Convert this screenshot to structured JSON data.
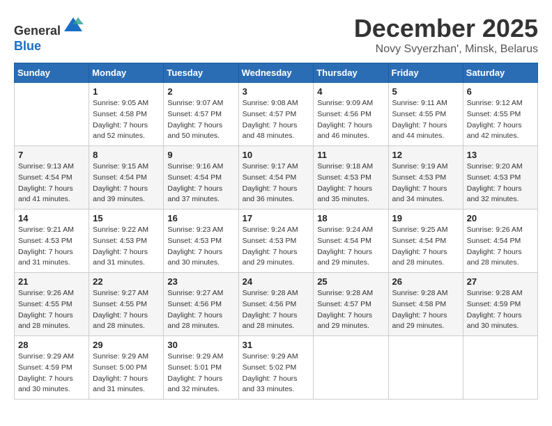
{
  "header": {
    "logo_line1": "General",
    "logo_line2": "Blue",
    "month_title": "December 2025",
    "subtitle": "Novy Svyerzhan', Minsk, Belarus"
  },
  "weekdays": [
    "Sunday",
    "Monday",
    "Tuesday",
    "Wednesday",
    "Thursday",
    "Friday",
    "Saturday"
  ],
  "weeks": [
    [
      {
        "day": "",
        "info": ""
      },
      {
        "day": "1",
        "info": "Sunrise: 9:05 AM\nSunset: 4:58 PM\nDaylight: 7 hours\nand 52 minutes."
      },
      {
        "day": "2",
        "info": "Sunrise: 9:07 AM\nSunset: 4:57 PM\nDaylight: 7 hours\nand 50 minutes."
      },
      {
        "day": "3",
        "info": "Sunrise: 9:08 AM\nSunset: 4:57 PM\nDaylight: 7 hours\nand 48 minutes."
      },
      {
        "day": "4",
        "info": "Sunrise: 9:09 AM\nSunset: 4:56 PM\nDaylight: 7 hours\nand 46 minutes."
      },
      {
        "day": "5",
        "info": "Sunrise: 9:11 AM\nSunset: 4:55 PM\nDaylight: 7 hours\nand 44 minutes."
      },
      {
        "day": "6",
        "info": "Sunrise: 9:12 AM\nSunset: 4:55 PM\nDaylight: 7 hours\nand 42 minutes."
      }
    ],
    [
      {
        "day": "7",
        "info": "Sunrise: 9:13 AM\nSunset: 4:54 PM\nDaylight: 7 hours\nand 41 minutes."
      },
      {
        "day": "8",
        "info": "Sunrise: 9:15 AM\nSunset: 4:54 PM\nDaylight: 7 hours\nand 39 minutes."
      },
      {
        "day": "9",
        "info": "Sunrise: 9:16 AM\nSunset: 4:54 PM\nDaylight: 7 hours\nand 37 minutes."
      },
      {
        "day": "10",
        "info": "Sunrise: 9:17 AM\nSunset: 4:54 PM\nDaylight: 7 hours\nand 36 minutes."
      },
      {
        "day": "11",
        "info": "Sunrise: 9:18 AM\nSunset: 4:53 PM\nDaylight: 7 hours\nand 35 minutes."
      },
      {
        "day": "12",
        "info": "Sunrise: 9:19 AM\nSunset: 4:53 PM\nDaylight: 7 hours\nand 34 minutes."
      },
      {
        "day": "13",
        "info": "Sunrise: 9:20 AM\nSunset: 4:53 PM\nDaylight: 7 hours\nand 32 minutes."
      }
    ],
    [
      {
        "day": "14",
        "info": "Sunrise: 9:21 AM\nSunset: 4:53 PM\nDaylight: 7 hours\nand 31 minutes."
      },
      {
        "day": "15",
        "info": "Sunrise: 9:22 AM\nSunset: 4:53 PM\nDaylight: 7 hours\nand 31 minutes."
      },
      {
        "day": "16",
        "info": "Sunrise: 9:23 AM\nSunset: 4:53 PM\nDaylight: 7 hours\nand 30 minutes."
      },
      {
        "day": "17",
        "info": "Sunrise: 9:24 AM\nSunset: 4:53 PM\nDaylight: 7 hours\nand 29 minutes."
      },
      {
        "day": "18",
        "info": "Sunrise: 9:24 AM\nSunset: 4:54 PM\nDaylight: 7 hours\nand 29 minutes."
      },
      {
        "day": "19",
        "info": "Sunrise: 9:25 AM\nSunset: 4:54 PM\nDaylight: 7 hours\nand 28 minutes."
      },
      {
        "day": "20",
        "info": "Sunrise: 9:26 AM\nSunset: 4:54 PM\nDaylight: 7 hours\nand 28 minutes."
      }
    ],
    [
      {
        "day": "21",
        "info": "Sunrise: 9:26 AM\nSunset: 4:55 PM\nDaylight: 7 hours\nand 28 minutes."
      },
      {
        "day": "22",
        "info": "Sunrise: 9:27 AM\nSunset: 4:55 PM\nDaylight: 7 hours\nand 28 minutes."
      },
      {
        "day": "23",
        "info": "Sunrise: 9:27 AM\nSunset: 4:56 PM\nDaylight: 7 hours\nand 28 minutes."
      },
      {
        "day": "24",
        "info": "Sunrise: 9:28 AM\nSunset: 4:56 PM\nDaylight: 7 hours\nand 28 minutes."
      },
      {
        "day": "25",
        "info": "Sunrise: 9:28 AM\nSunset: 4:57 PM\nDaylight: 7 hours\nand 29 minutes."
      },
      {
        "day": "26",
        "info": "Sunrise: 9:28 AM\nSunset: 4:58 PM\nDaylight: 7 hours\nand 29 minutes."
      },
      {
        "day": "27",
        "info": "Sunrise: 9:28 AM\nSunset: 4:59 PM\nDaylight: 7 hours\nand 30 minutes."
      }
    ],
    [
      {
        "day": "28",
        "info": "Sunrise: 9:29 AM\nSunset: 4:59 PM\nDaylight: 7 hours\nand 30 minutes."
      },
      {
        "day": "29",
        "info": "Sunrise: 9:29 AM\nSunset: 5:00 PM\nDaylight: 7 hours\nand 31 minutes."
      },
      {
        "day": "30",
        "info": "Sunrise: 9:29 AM\nSunset: 5:01 PM\nDaylight: 7 hours\nand 32 minutes."
      },
      {
        "day": "31",
        "info": "Sunrise: 9:29 AM\nSunset: 5:02 PM\nDaylight: 7 hours\nand 33 minutes."
      },
      {
        "day": "",
        "info": ""
      },
      {
        "day": "",
        "info": ""
      },
      {
        "day": "",
        "info": ""
      }
    ]
  ]
}
